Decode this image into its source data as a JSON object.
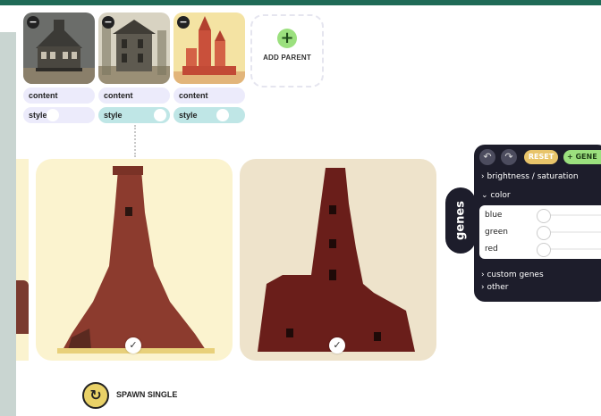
{
  "parents": [
    {
      "content_label": "content",
      "style_label": "style",
      "style_on": false
    },
    {
      "content_label": "content",
      "style_label": "style",
      "style_on": true
    },
    {
      "content_label": "content",
      "style_label": "style",
      "style_on": true
    }
  ],
  "add_parent": {
    "label": "ADD PARENT"
  },
  "spawn": {
    "label": "SPAWN SINGLE"
  },
  "genes": {
    "tab_label": "genes",
    "reset_label": "RESET",
    "add_gene_label": "+ GENE",
    "sections": {
      "brightness": "› brightness / saturation",
      "color": "⌄ color",
      "custom": "› custom genes",
      "other": "› other"
    },
    "color_genes": [
      {
        "name": "blue"
      },
      {
        "name": "green"
      },
      {
        "name": "red"
      }
    ]
  },
  "colors": {
    "accent_green": "#9be07e",
    "reset_yellow": "#e8c46a",
    "panel_dark": "#1d1d2b",
    "top_bar": "#1f6b57"
  }
}
